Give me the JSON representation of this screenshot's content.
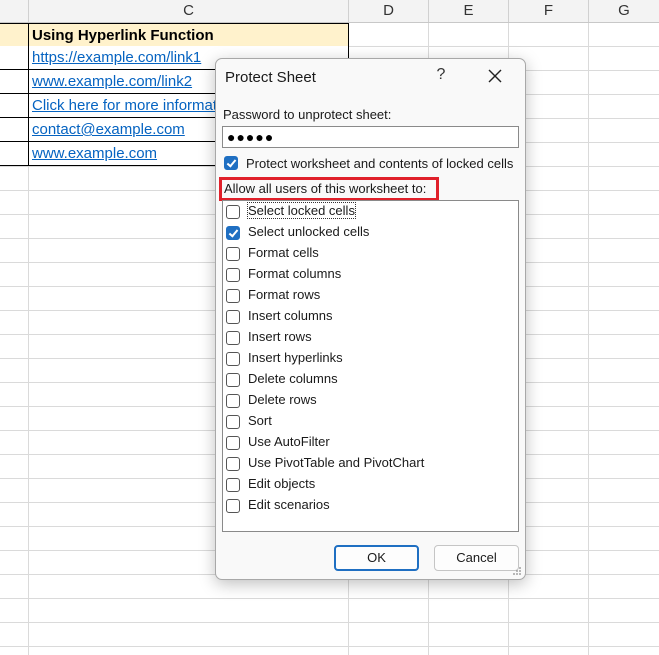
{
  "sheet": {
    "columns": [
      "C",
      "D",
      "E",
      "F",
      "G"
    ],
    "header": "Using Hyperlink Function",
    "links": [
      "https://example.com/link1",
      "www.example.com/link2",
      "Click here for more information",
      "contact@example.com",
      "www.example.com"
    ]
  },
  "dialog": {
    "title": "Protect Sheet",
    "help_label": "?",
    "password_label": "Password to unprotect sheet:",
    "password_value": "●●●●●",
    "protect_label": "Protect worksheet and contents of locked cells",
    "protect_checked": true,
    "allow_label": "Allow all users of this worksheet to:",
    "permissions": [
      {
        "label": "Select locked cells",
        "checked": false
      },
      {
        "label": "Select unlocked cells",
        "checked": true
      },
      {
        "label": "Format cells",
        "checked": false
      },
      {
        "label": "Format columns",
        "checked": false
      },
      {
        "label": "Format rows",
        "checked": false
      },
      {
        "label": "Insert columns",
        "checked": false
      },
      {
        "label": "Insert rows",
        "checked": false
      },
      {
        "label": "Insert hyperlinks",
        "checked": false
      },
      {
        "label": "Delete columns",
        "checked": false
      },
      {
        "label": "Delete rows",
        "checked": false
      },
      {
        "label": "Sort",
        "checked": false
      },
      {
        "label": "Use AutoFilter",
        "checked": false
      },
      {
        "label": "Use PivotTable and PivotChart",
        "checked": false
      },
      {
        "label": "Edit objects",
        "checked": false
      },
      {
        "label": "Edit scenarios",
        "checked": false
      }
    ],
    "ok_label": "OK",
    "cancel_label": "Cancel",
    "highlight_color": "#e0202a",
    "accent_color": "#1f6fc2"
  }
}
